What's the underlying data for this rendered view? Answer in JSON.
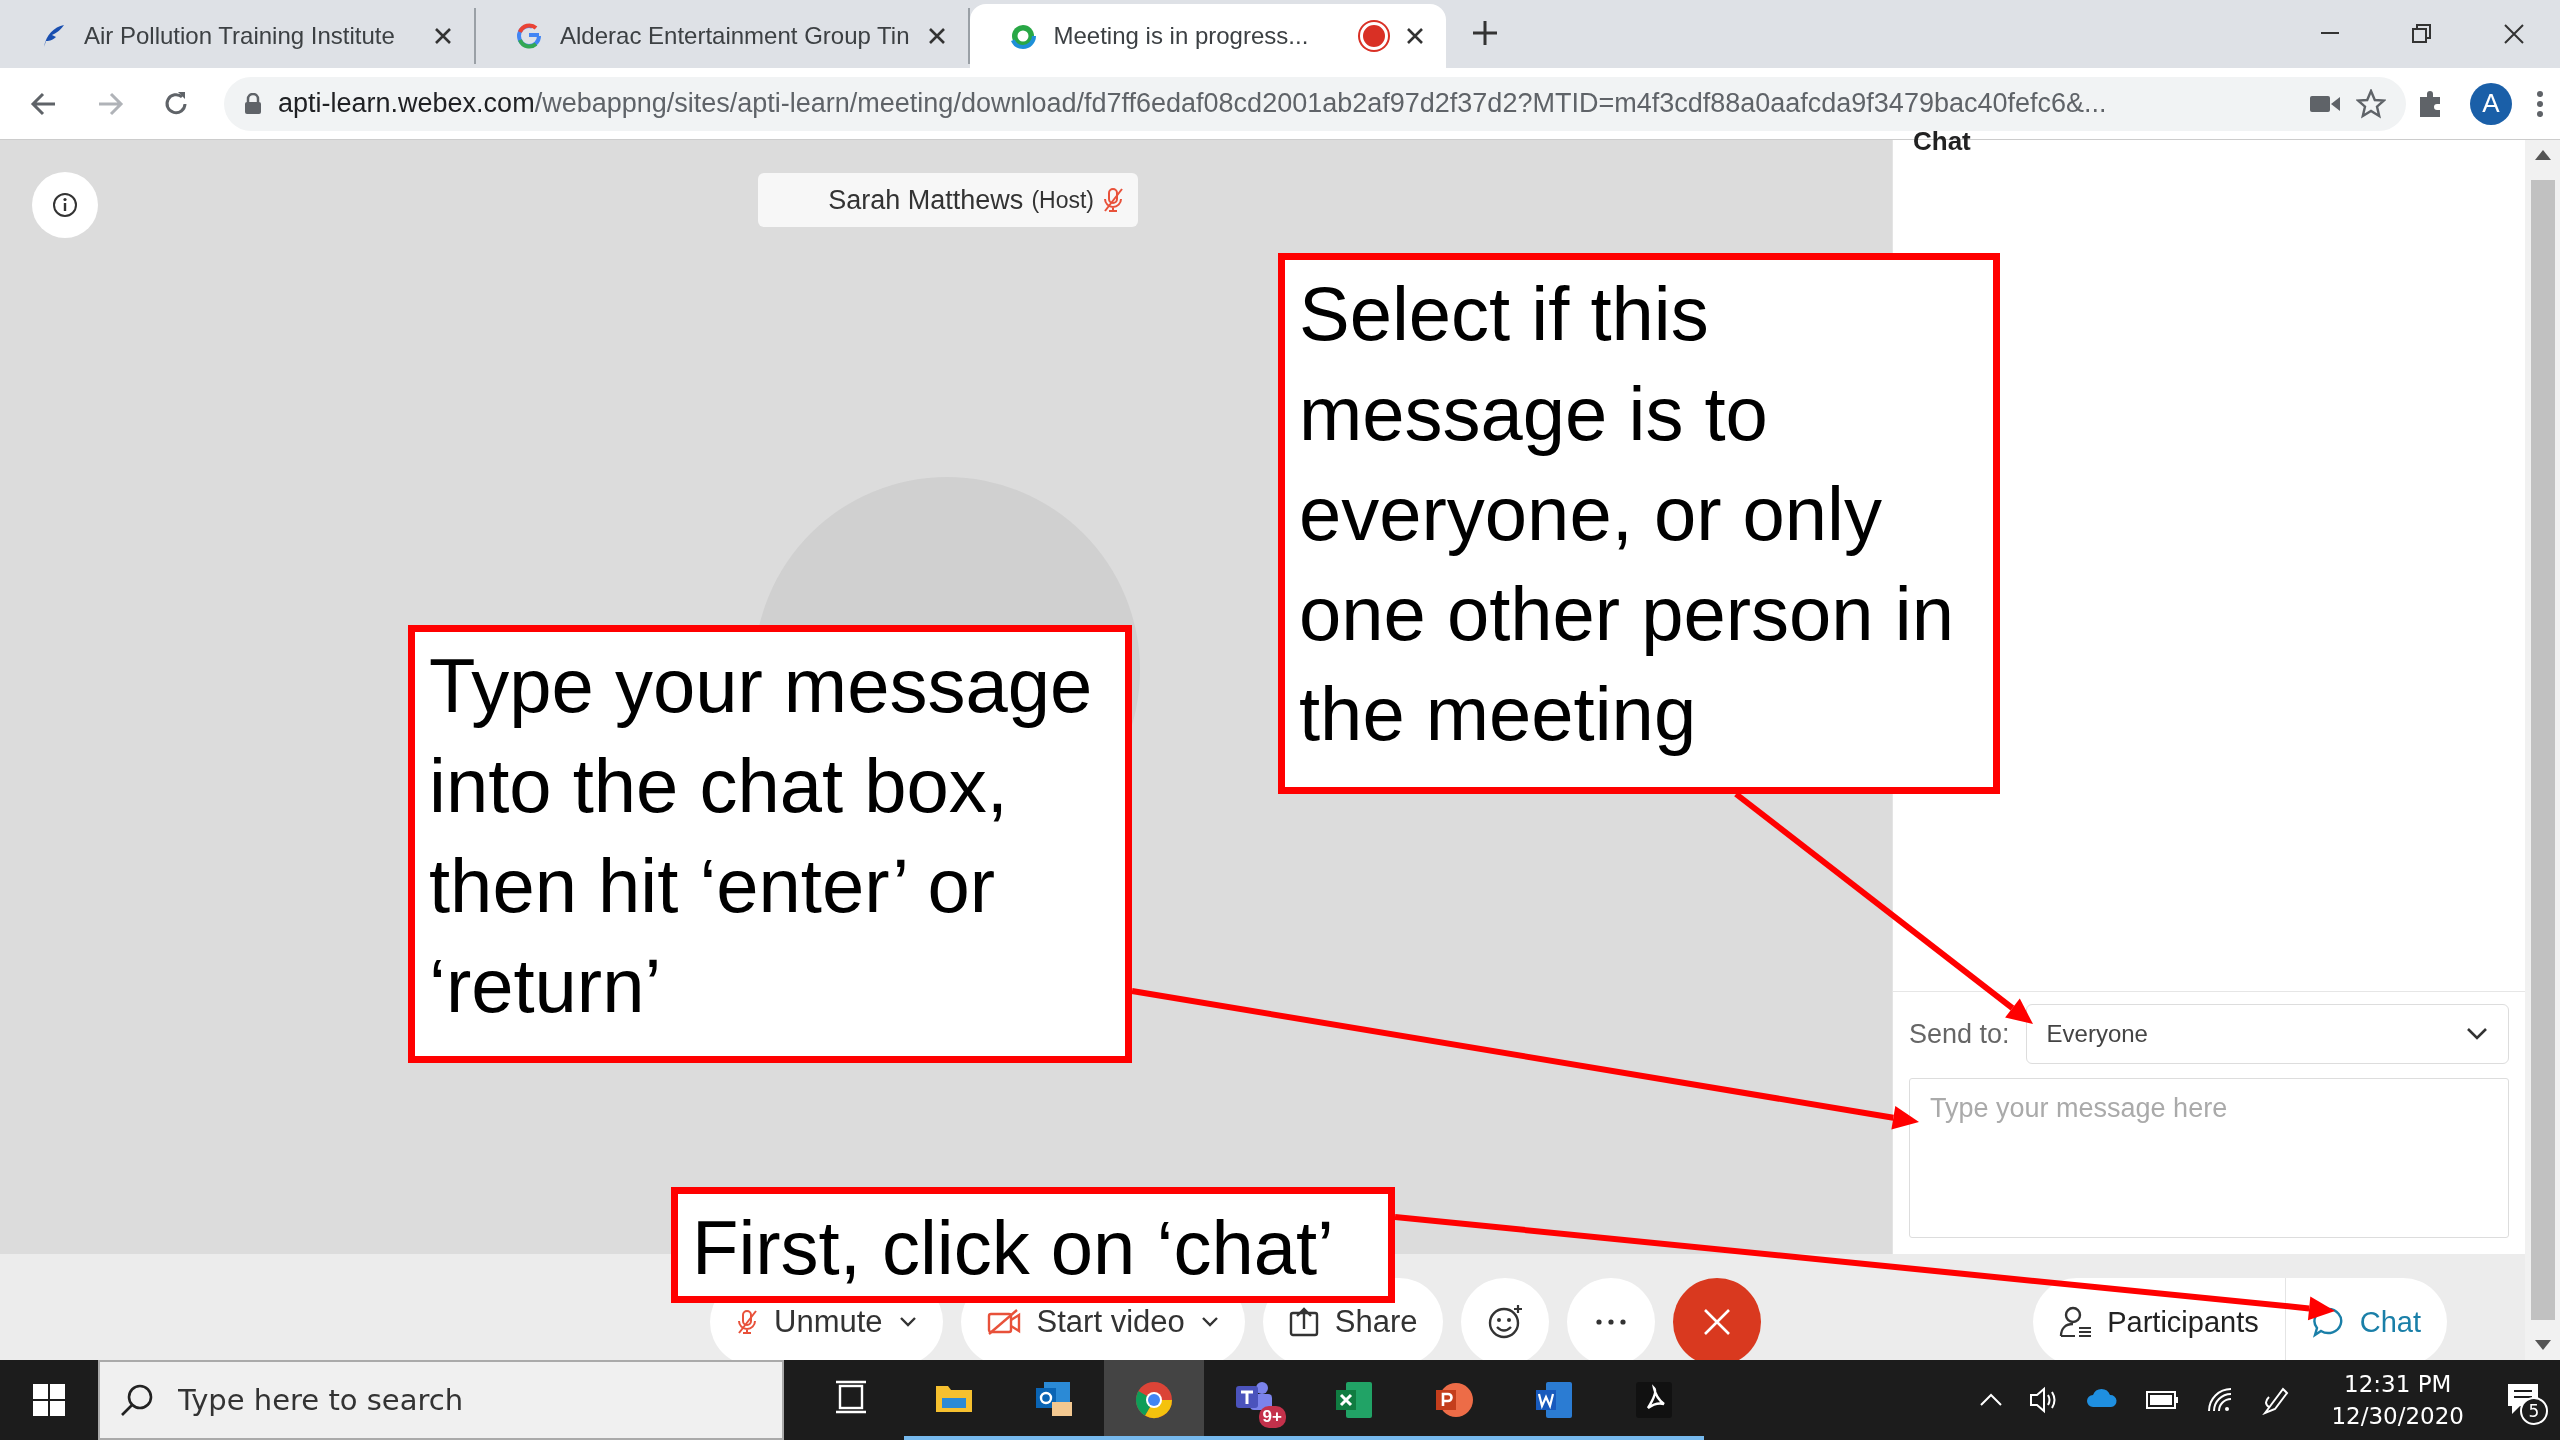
{
  "browser": {
    "tabs": [
      {
        "title": "Air Pollution Training Institute",
        "selected": false,
        "recording": false
      },
      {
        "title": "Alderac Entertainment Group Tin",
        "selected": false,
        "recording": false
      },
      {
        "title": "Meeting is in progress...",
        "selected": true,
        "recording": true
      }
    ],
    "address": {
      "domain": "apti-learn.webex.com",
      "path": "/webappng/sites/apti-learn/meeting/download/fd7ff6edaf08cd2001ab2af97d2f37d2?MTID=m4f3cdf88a0aafcda9f3479bac40fefc6&..."
    },
    "profile_initial": "A"
  },
  "meeting": {
    "participant": {
      "name": "Sarah Matthews",
      "role": "(Host)",
      "muted": true
    },
    "controls": [
      {
        "kind": "dropdown",
        "label": "Unmute"
      },
      {
        "kind": "dropdown",
        "label": "Start video"
      },
      {
        "kind": "button",
        "label": "Share"
      },
      {
        "kind": "emoji"
      },
      {
        "kind": "more"
      },
      {
        "kind": "end"
      }
    ],
    "panel_buttons": [
      {
        "label": "Participants",
        "selected": false
      },
      {
        "label": "Chat",
        "selected": true
      }
    ]
  },
  "chat": {
    "title": "Chat",
    "send_to_label": "Send to:",
    "send_to_value": "Everyone",
    "message": {
      "placeholder": "Type your message here"
    }
  },
  "annotations": [
    {
      "text": "Select if this message is to everyone, or only one other person in the meeting"
    },
    {
      "text": "Type your message into the chat box, then hit ‘enter’ or ‘return’"
    },
    {
      "text": "First, click on ‘chat’"
    }
  ],
  "taskbar": {
    "search": {
      "placeholder": "Type here to search"
    },
    "teams_badge": "9+",
    "time": "12:31 PM",
    "date": "12/30/2020",
    "notifications": "5"
  }
}
